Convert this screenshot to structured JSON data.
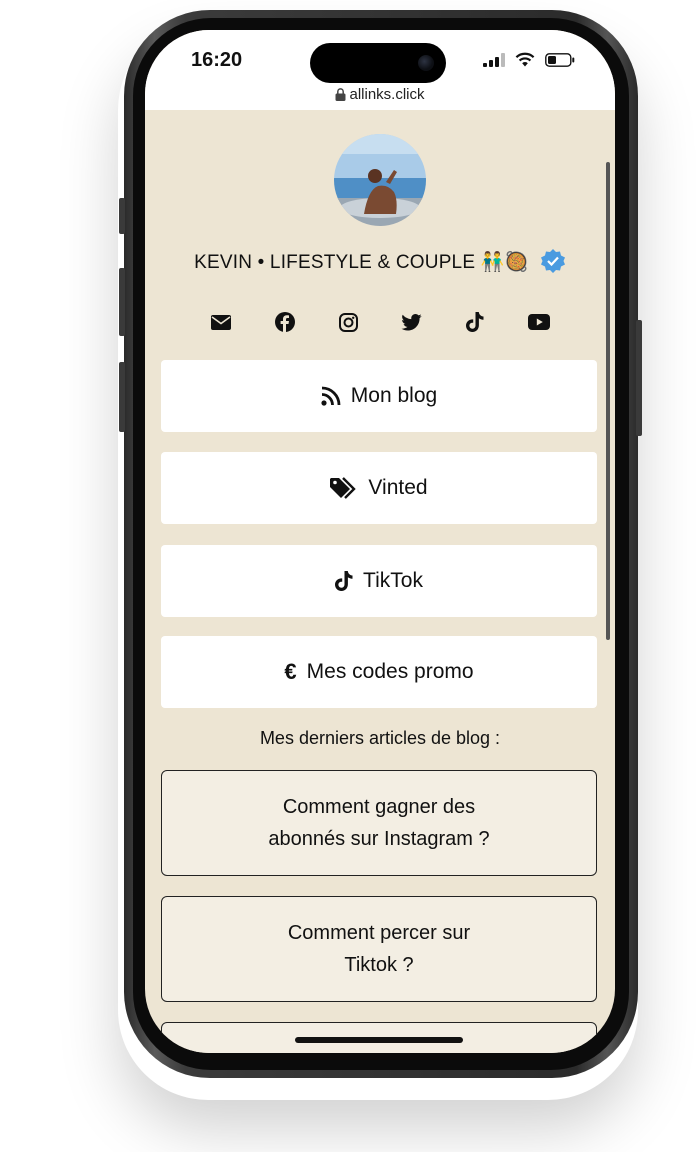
{
  "status_bar": {
    "time": "16:20"
  },
  "browser": {
    "url": "allinks.click"
  },
  "profile": {
    "name": "KEVIN • LIFESTYLE & COUPLE 👬🥘"
  },
  "socials": [
    "mail-icon",
    "facebook-icon",
    "instagram-icon",
    "twitter-icon",
    "tiktok-icon",
    "youtube-icon"
  ],
  "links": [
    {
      "label": "Mon blog",
      "icon": "rss-icon"
    },
    {
      "label": "Vinted",
      "icon": "tags-icon"
    },
    {
      "label": "TikTok",
      "icon": "tiktok-icon"
    },
    {
      "label": "Mes codes promo",
      "icon": "euro-icon"
    }
  ],
  "articles_section": {
    "title": "Mes derniers articles de blog :",
    "articles": [
      {
        "line1": "Comment gagner des",
        "line2": "abonnés sur Instagram ?"
      },
      {
        "line1": "Comment percer sur",
        "line2": "Tiktok ?"
      }
    ]
  },
  "colors": {
    "page_bg": "#ede5d3",
    "button_bg": "#ffffff",
    "article_bg": "#f3eee3",
    "verified": "#4a9be0"
  }
}
